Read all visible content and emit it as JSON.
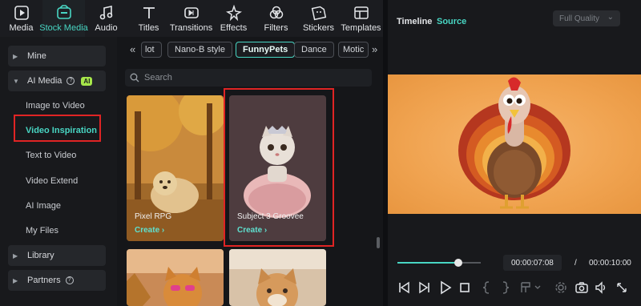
{
  "toolbar": {
    "items": [
      {
        "label": "Media",
        "icon": "media-icon"
      },
      {
        "label": "Stock Media",
        "icon": "stock-media-icon"
      },
      {
        "label": "Audio",
        "icon": "music-note-icon"
      },
      {
        "label": "Titles",
        "icon": "text-icon"
      },
      {
        "label": "Transitions",
        "icon": "transition-icon"
      },
      {
        "label": "Effects",
        "icon": "sparkle-icon"
      },
      {
        "label": "Filters",
        "icon": "filter-icon"
      },
      {
        "label": "Stickers",
        "icon": "sticker-icon"
      },
      {
        "label": "Templates",
        "icon": "template-icon"
      }
    ],
    "active_index": 1,
    "accent": "#48d6c3"
  },
  "sidebar": {
    "groups": {
      "mine": "Mine",
      "ai_media": "AI Media",
      "ai_badge": "AI",
      "library": "Library",
      "partners": "Partners"
    },
    "sub_items": [
      "Image to Video",
      "Video Inspiration",
      "Text to Video",
      "Video Extend",
      "AI Image",
      "My Files"
    ],
    "active_sub": "Video Inspiration",
    "highlight_color": "#e02424"
  },
  "content": {
    "chips": [
      "lot",
      "Nano-B style",
      "FunnyPets",
      "Dance",
      "Motic"
    ],
    "active_chip": "FunnyPets",
    "search_placeholder": "Search",
    "cards": [
      {
        "title": "Pixel RPG",
        "action": "Create"
      },
      {
        "title": "Subject 3 Groovee",
        "action": "Create"
      }
    ]
  },
  "right_panel": {
    "tabs": [
      "Timeline",
      "Source"
    ],
    "active_tab": "Source",
    "quality": "Full Quality",
    "current_time": "00:00:07:08",
    "separator": "/",
    "total_time": "00:00:10:00",
    "progress": 0.73
  }
}
